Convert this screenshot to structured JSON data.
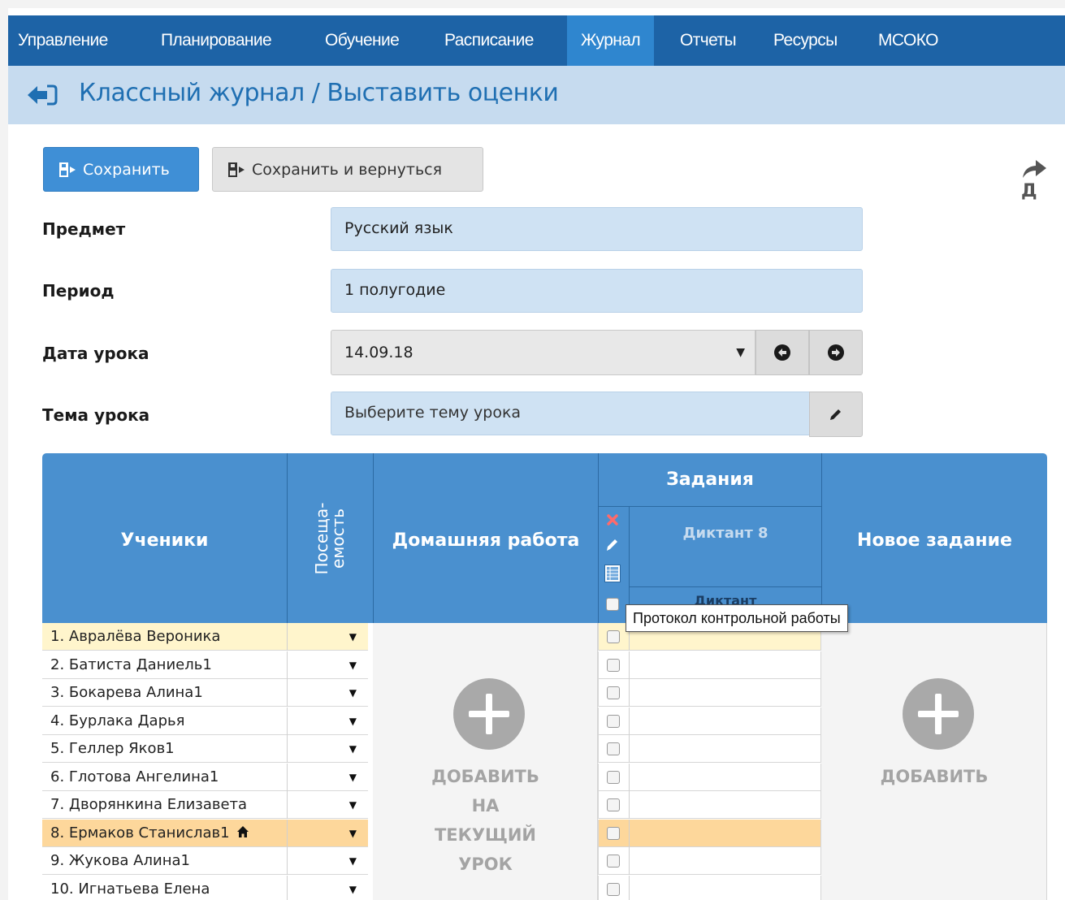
{
  "nav": {
    "items": [
      {
        "label": "Управление",
        "active": false
      },
      {
        "label": "Планирование",
        "active": false
      },
      {
        "label": "Обучение",
        "active": false
      },
      {
        "label": "Расписание",
        "active": false
      },
      {
        "label": "Журнал",
        "active": true
      },
      {
        "label": "Отчеты",
        "active": false
      },
      {
        "label": "Ресурсы",
        "active": false
      },
      {
        "label": "МСОКО",
        "active": false
      }
    ]
  },
  "header": {
    "title": "Классный журнал / Выставить оценки",
    "back_icon": "back-arrow-icon"
  },
  "toolbar": {
    "save_label": "Сохранить",
    "save_return_label": "Сохранить и вернуться",
    "forward_letter": "Д"
  },
  "form": {
    "subject_label": "Предмет",
    "subject_value": "Русский язык",
    "period_label": "Период",
    "period_value": "1 полугодие",
    "date_label": "Дата урока",
    "date_value": "14.09.18",
    "topic_label": "Тема урока",
    "topic_placeholder": "Выберите тему урока"
  },
  "table": {
    "students_header": "Ученики",
    "attendance_header_1": "Посеща-",
    "attendance_header_2": "емость",
    "homework_header": "Домашняя работа",
    "tasks_header": "Задания",
    "task_name": "Диктант 8",
    "task_short": "Диктант",
    "new_task_header": "Новое задание",
    "homework_add": [
      "ДОБАВИТЬ",
      "НА",
      "ТЕКУЩИЙ",
      "УРОК"
    ],
    "new_task_add": "ДОБАВИТЬ",
    "tooltip": "Протокол контрольной работы",
    "students": [
      {
        "name": "1. Авралёва Вероника",
        "highlight": "hl1",
        "home": false
      },
      {
        "name": "2. Батиста Даниель1",
        "highlight": "",
        "home": false
      },
      {
        "name": "3. Бокарева Алина1",
        "highlight": "",
        "home": false
      },
      {
        "name": "4. Бурлака Дарья",
        "highlight": "",
        "home": false
      },
      {
        "name": "5. Геллер Яков1",
        "highlight": "",
        "home": false
      },
      {
        "name": "6. Глотова Ангелина1",
        "highlight": "",
        "home": false
      },
      {
        "name": "7. Дворянкина Елизавета",
        "highlight": "",
        "home": false
      },
      {
        "name": "8. Ермаков Станислав1",
        "highlight": "hl2",
        "home": true
      },
      {
        "name": "9. Жукова Алина1",
        "highlight": "",
        "home": false
      },
      {
        "name": "10. Игнатьева Елена",
        "highlight": "",
        "home": false
      }
    ]
  },
  "colors": {
    "nav": "#1d63a6",
    "nav_active": "#2f86cf",
    "header_band": "#c6dbef",
    "table_head": "#4a90cf",
    "row_highlight": "#fff5cc",
    "row_selected": "#fdd79b"
  }
}
